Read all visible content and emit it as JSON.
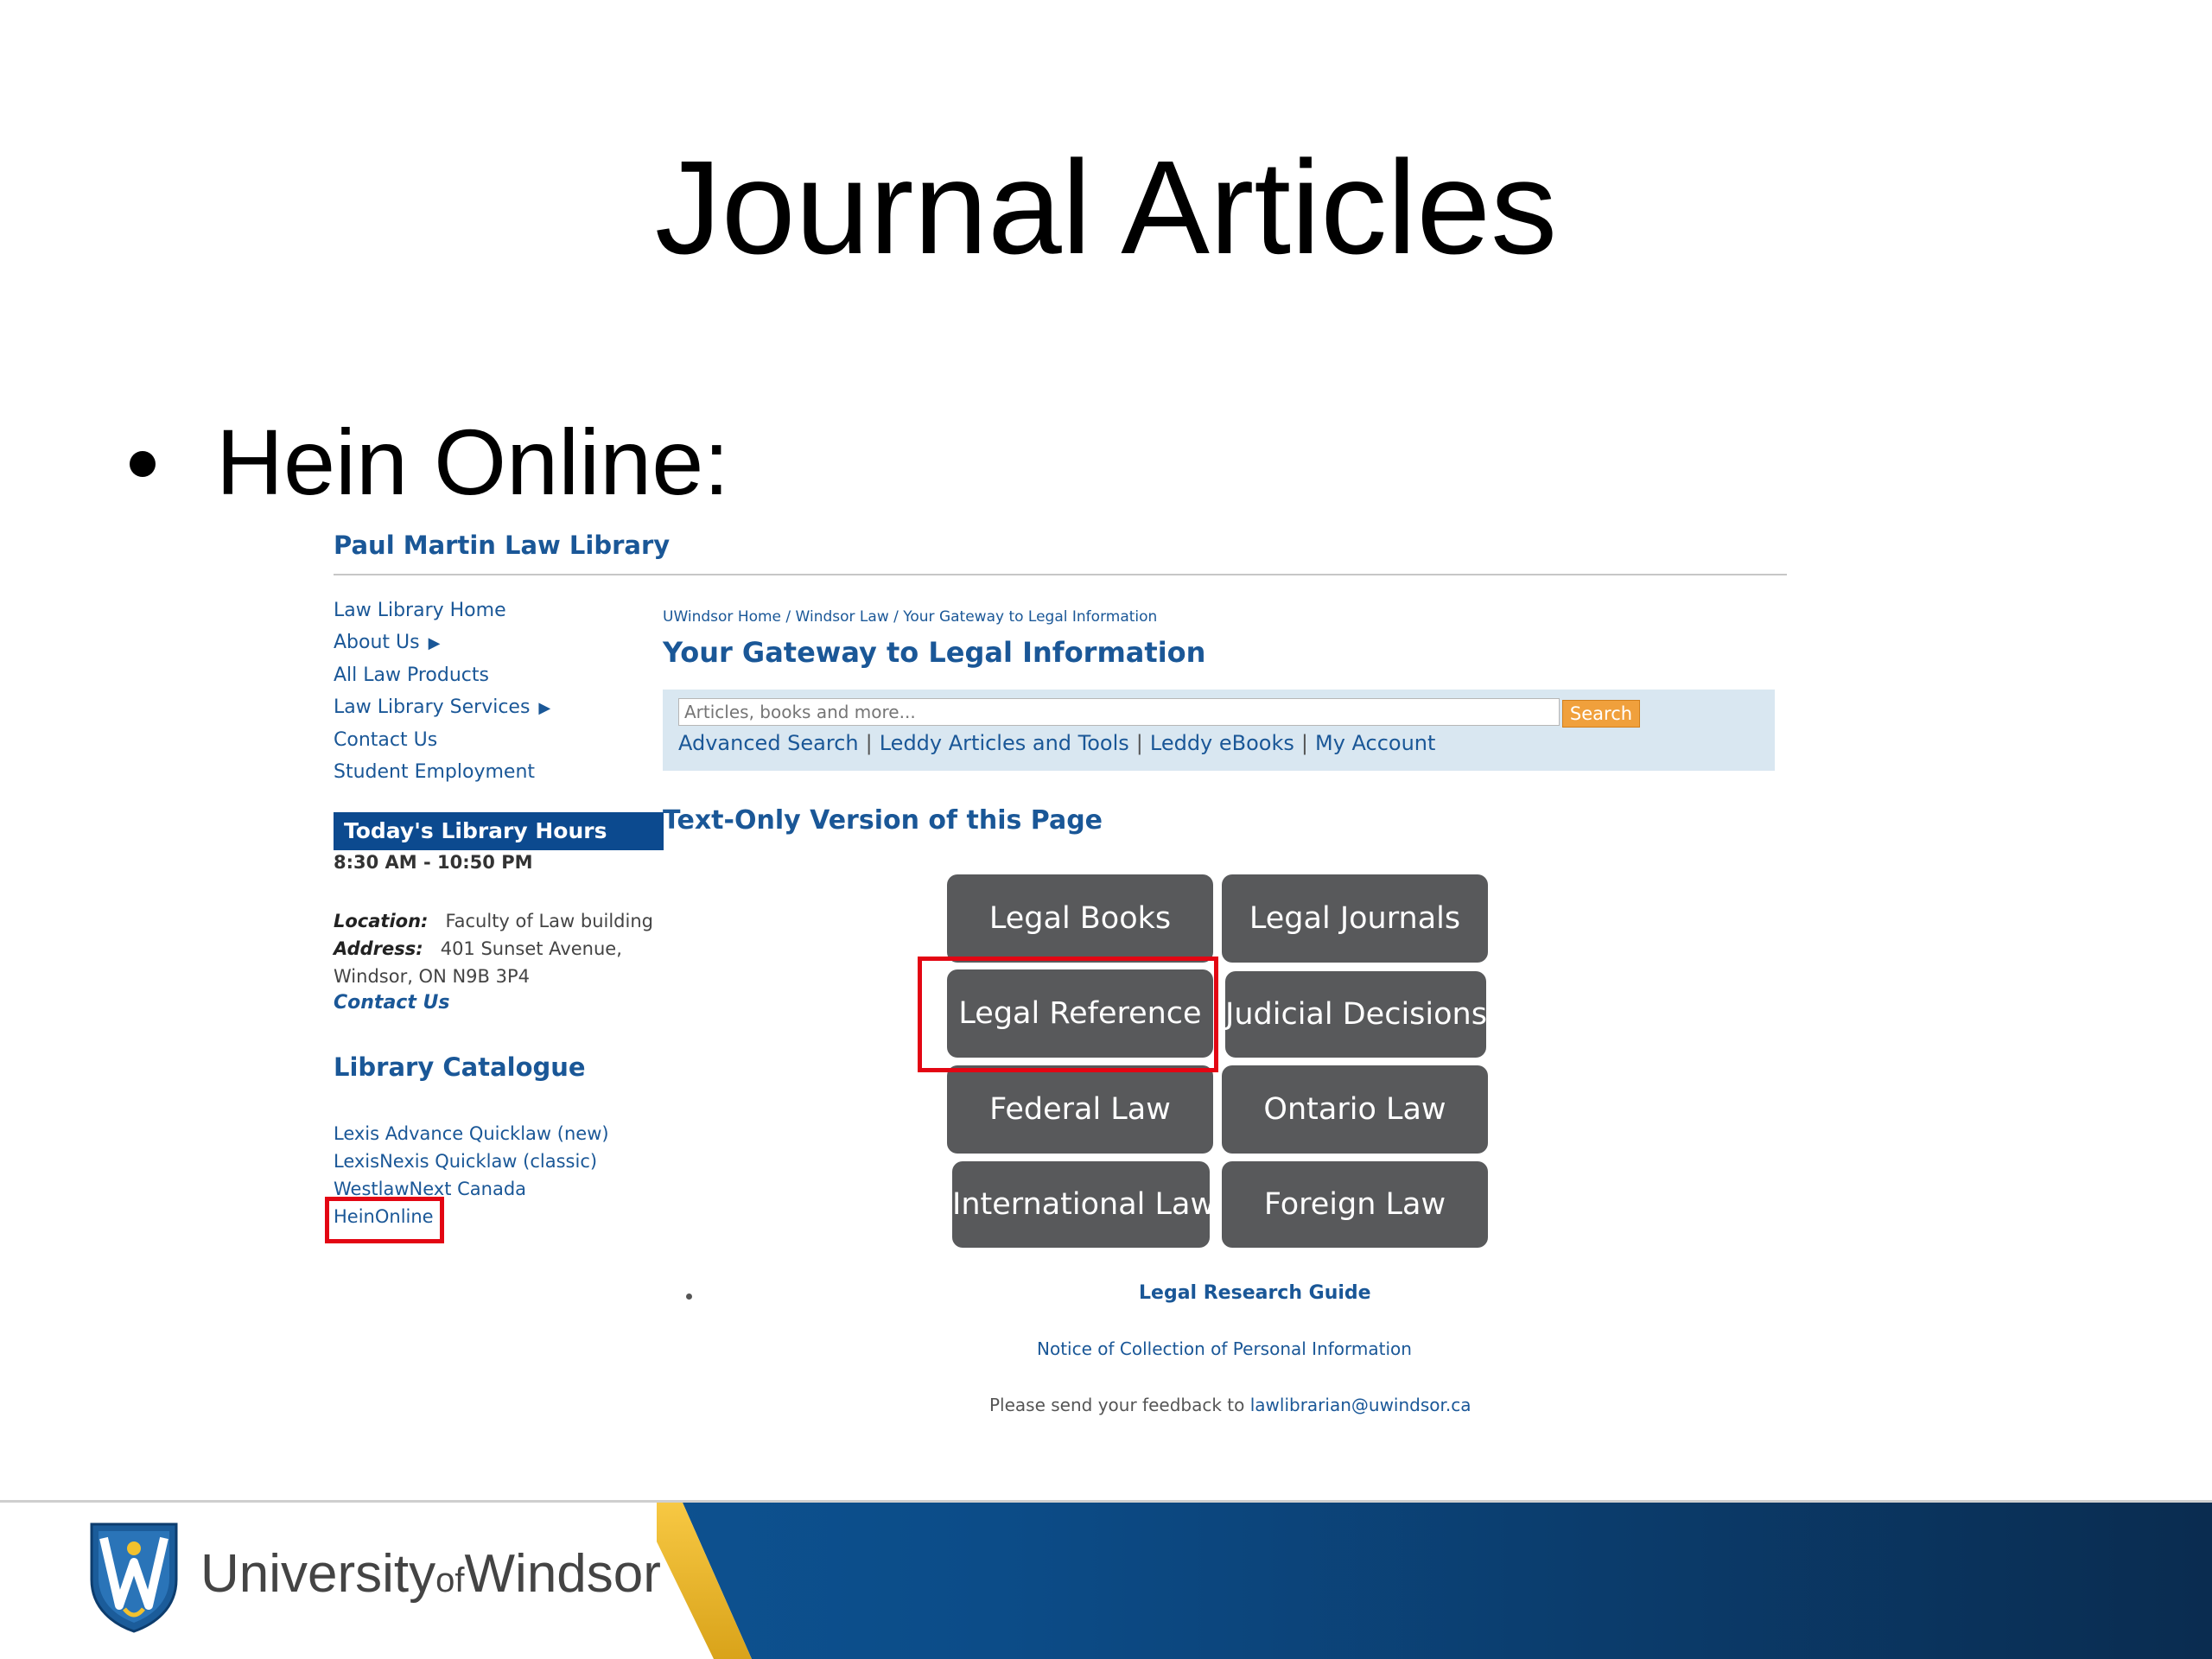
{
  "slide": {
    "title": "Journal Articles",
    "bullet": "Hein Online:"
  },
  "library": {
    "title": "Paul Martin Law Library",
    "nav": [
      {
        "label": "Law Library Home"
      },
      {
        "label": "About Us",
        "arrow": "▶"
      },
      {
        "label": "All Law Products"
      },
      {
        "label": "Law Library Services",
        "arrow": "▶"
      },
      {
        "label": "Contact Us"
      },
      {
        "label": "Student Employment"
      }
    ],
    "breadcrumb": "UWindsor Home / Windsor Law / Your Gateway to Legal Information",
    "gateway_title": "Your Gateway to Legal Information",
    "search": {
      "placeholder": "Articles, books and more...",
      "button": "Search",
      "links": [
        "Advanced Search",
        "Leddy Articles and Tools",
        "Leddy eBooks",
        "My Account"
      ],
      "separator": "|"
    },
    "hours": {
      "title": "Today's Library Hours",
      "value": "8:30 AM - 10:50 PM"
    },
    "text_only": "Text-Only Version of this Page",
    "location": {
      "location_label": "Location:",
      "location_value": "Faculty of Law building",
      "address_label": "Address:",
      "address_line1": "401 Sunset Avenue,",
      "address_line2": "Windsor, ON N9B 3P4",
      "contact": "Contact Us"
    },
    "catalogue": "Library Catalogue",
    "resources": [
      "Lexis Advance Quicklaw (new)",
      "LexisNexis Quicklaw (classic)",
      "WestlawNext Canada",
      "HeinOnline"
    ],
    "tiles": [
      "Legal Books",
      "Legal Journals",
      "Legal Reference",
      "Judicial Decisions",
      "Federal Law",
      "Ontario Law",
      "International Law",
      "Foreign Law"
    ],
    "research_guide": "Legal Research Guide",
    "notice": "Notice of Collection of Personal Information",
    "feedback_prefix": "Please send your feedback to ",
    "feedback_email": "lawlibrarian@uwindsor.ca",
    "highlight_color": "#e30613"
  },
  "footer": {
    "name_part1": "University",
    "name_of": "of",
    "name_part2": "Windsor"
  }
}
